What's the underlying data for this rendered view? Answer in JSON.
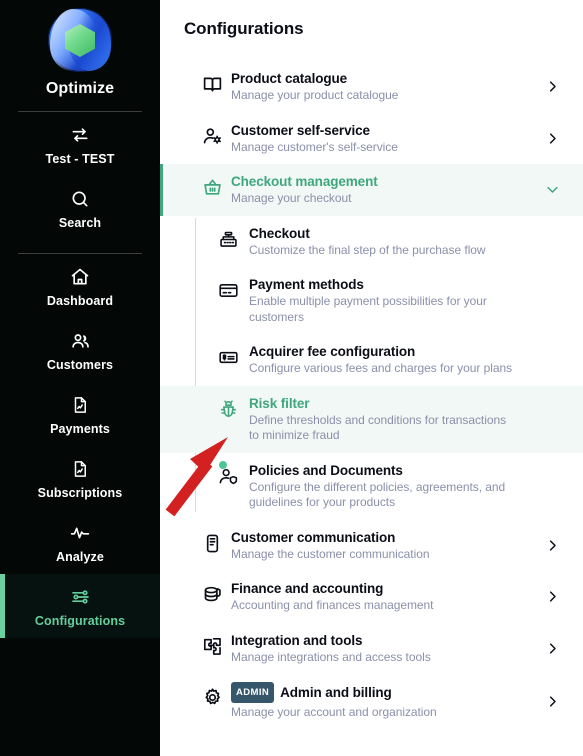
{
  "sidebar": {
    "brand": {
      "name": "Optimize",
      "logo_icon": "optimize-logo"
    },
    "items": [
      {
        "label": "Test - TEST",
        "icon": "switch-arrows-icon",
        "active": false
      },
      {
        "label": "Search",
        "icon": "search-icon",
        "active": false
      },
      {
        "label": "Dashboard",
        "icon": "home-icon",
        "active": false
      },
      {
        "label": "Customers",
        "icon": "users-icon",
        "active": false
      },
      {
        "label": "Payments",
        "icon": "document-chart-icon",
        "active": false
      },
      {
        "label": "Subscriptions",
        "icon": "document-chart-icon",
        "active": false
      },
      {
        "label": "Analyze",
        "icon": "pulse-icon",
        "active": false
      },
      {
        "label": "Configurations",
        "icon": "sliders-icon",
        "active": true
      }
    ]
  },
  "main": {
    "title": "Configurations",
    "rows": [
      {
        "title": "Product catalogue",
        "subtitle": "Manage your product catalogue",
        "icon": "book-icon",
        "chevron": "chevron-right"
      },
      {
        "title": "Customer self-service",
        "subtitle": "Manage customer's self-service",
        "icon": "user-gear-icon",
        "chevron": "chevron-right"
      },
      {
        "title": "Checkout management",
        "subtitle": "Manage your checkout",
        "icon": "basket-icon",
        "chevron": "chevron-down",
        "expanded": true
      }
    ],
    "sub_rows": [
      {
        "title": "Checkout",
        "subtitle": "Customize the final step of the purchase flow",
        "icon": "cash-register-icon"
      },
      {
        "title": "Payment methods",
        "subtitle": "Enable multiple payment possibilities for your customers",
        "icon": "credit-card-icon"
      },
      {
        "title": "Acquirer fee configuration",
        "subtitle": "Configure various fees and charges for your plans",
        "icon": "price-tag-icon"
      },
      {
        "title": "Risk filter",
        "subtitle": "Define thresholds and conditions for transactions to minimize fraud",
        "icon": "shield-bug-icon",
        "selected": true
      },
      {
        "title": "Policies and Documents",
        "subtitle": "Configure the different policies, agreements, and guidelines for your products",
        "icon": "user-shield-icon",
        "has_dot": true
      }
    ],
    "rows_bottom": [
      {
        "title": "Customer communication",
        "subtitle": "Manage the customer communication",
        "icon": "megaphone-icon",
        "chevron": "chevron-right"
      },
      {
        "title": "Finance and accounting",
        "subtitle": "Accounting and finances management",
        "icon": "coins-icon",
        "chevron": "chevron-right"
      },
      {
        "title": "Integration and tools",
        "subtitle": "Manage integrations and access tools",
        "icon": "puzzle-icon",
        "chevron": "chevron-right"
      },
      {
        "title": "Admin and billing",
        "subtitle": "Manage your account and organization",
        "icon": "gear-icon",
        "chevron": "chevron-right",
        "badge": "ADMIN"
      }
    ]
  },
  "annotation": {
    "arrow_color": "#d32020",
    "points_to": "Risk filter"
  },
  "colors": {
    "accent_green": "#3fa67e",
    "sidebar_accent": "#6bd0a0",
    "highlight_bg": "#f1f8f5",
    "subtitle": "#8b90ab",
    "badge_bg": "#36566b"
  }
}
